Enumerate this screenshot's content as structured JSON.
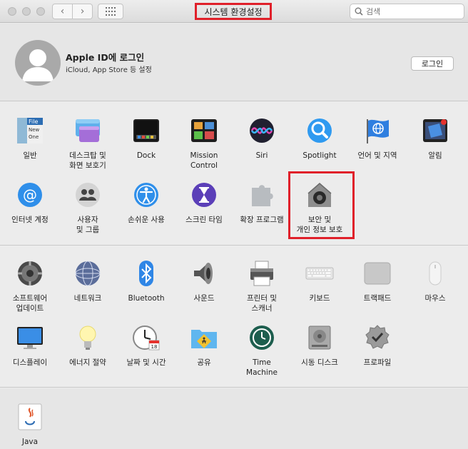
{
  "titlebar": {
    "title": "시스템 환경설정",
    "back": "‹",
    "forward": "›",
    "search_placeholder": "검색"
  },
  "apple_id": {
    "title": "Apple ID에 로그인",
    "subtitle": "iCloud, App Store 등 설정",
    "login_button": "로그인"
  },
  "section1": [
    {
      "label": "일반",
      "icon": "general-icon"
    },
    {
      "label": "데스크탑 및\n화면 보호기",
      "icon": "desktop-screensaver-icon"
    },
    {
      "label": "Dock",
      "icon": "dock-icon"
    },
    {
      "label": "Mission\nControl",
      "icon": "mission-control-icon"
    },
    {
      "label": "Siri",
      "icon": "siri-icon"
    },
    {
      "label": "Spotlight",
      "icon": "spotlight-icon"
    },
    {
      "label": "언어 및 지역",
      "icon": "language-region-icon"
    },
    {
      "label": "알림",
      "icon": "notifications-icon"
    },
    {
      "label": "인터넷 계정",
      "icon": "internet-accounts-icon"
    },
    {
      "label": "사용자\n및 그룹",
      "icon": "users-groups-icon"
    },
    {
      "label": "손쉬운 사용",
      "icon": "accessibility-icon"
    },
    {
      "label": "스크린 타임",
      "icon": "screen-time-icon"
    },
    {
      "label": "확장 프로그램",
      "icon": "extensions-icon"
    },
    {
      "label": "보안 및\n개인 정보 보호",
      "icon": "security-privacy-icon"
    }
  ],
  "section2": [
    {
      "label": "소프트웨어\n업데이트",
      "icon": "software-update-icon"
    },
    {
      "label": "네트워크",
      "icon": "network-icon"
    },
    {
      "label": "Bluetooth",
      "icon": "bluetooth-icon"
    },
    {
      "label": "사운드",
      "icon": "sound-icon"
    },
    {
      "label": "프린터 및\n스캐너",
      "icon": "printers-scanners-icon"
    },
    {
      "label": "키보드",
      "icon": "keyboard-icon"
    },
    {
      "label": "트랙패드",
      "icon": "trackpad-icon"
    },
    {
      "label": "마우스",
      "icon": "mouse-icon"
    },
    {
      "label": "디스플레이",
      "icon": "displays-icon"
    },
    {
      "label": "에너지 절약",
      "icon": "energy-saver-icon"
    },
    {
      "label": "날짜 및 시간",
      "icon": "date-time-icon"
    },
    {
      "label": "공유",
      "icon": "sharing-icon"
    },
    {
      "label": "Time\nMachine",
      "icon": "time-machine-icon"
    },
    {
      "label": "시동 디스크",
      "icon": "startup-disk-icon"
    },
    {
      "label": "프로파일",
      "icon": "profiles-icon"
    }
  ],
  "section3": [
    {
      "label": "Java",
      "icon": "java-icon"
    }
  ],
  "general_icon_text": [
    "File",
    "New",
    "One"
  ],
  "calendar_day": "18"
}
